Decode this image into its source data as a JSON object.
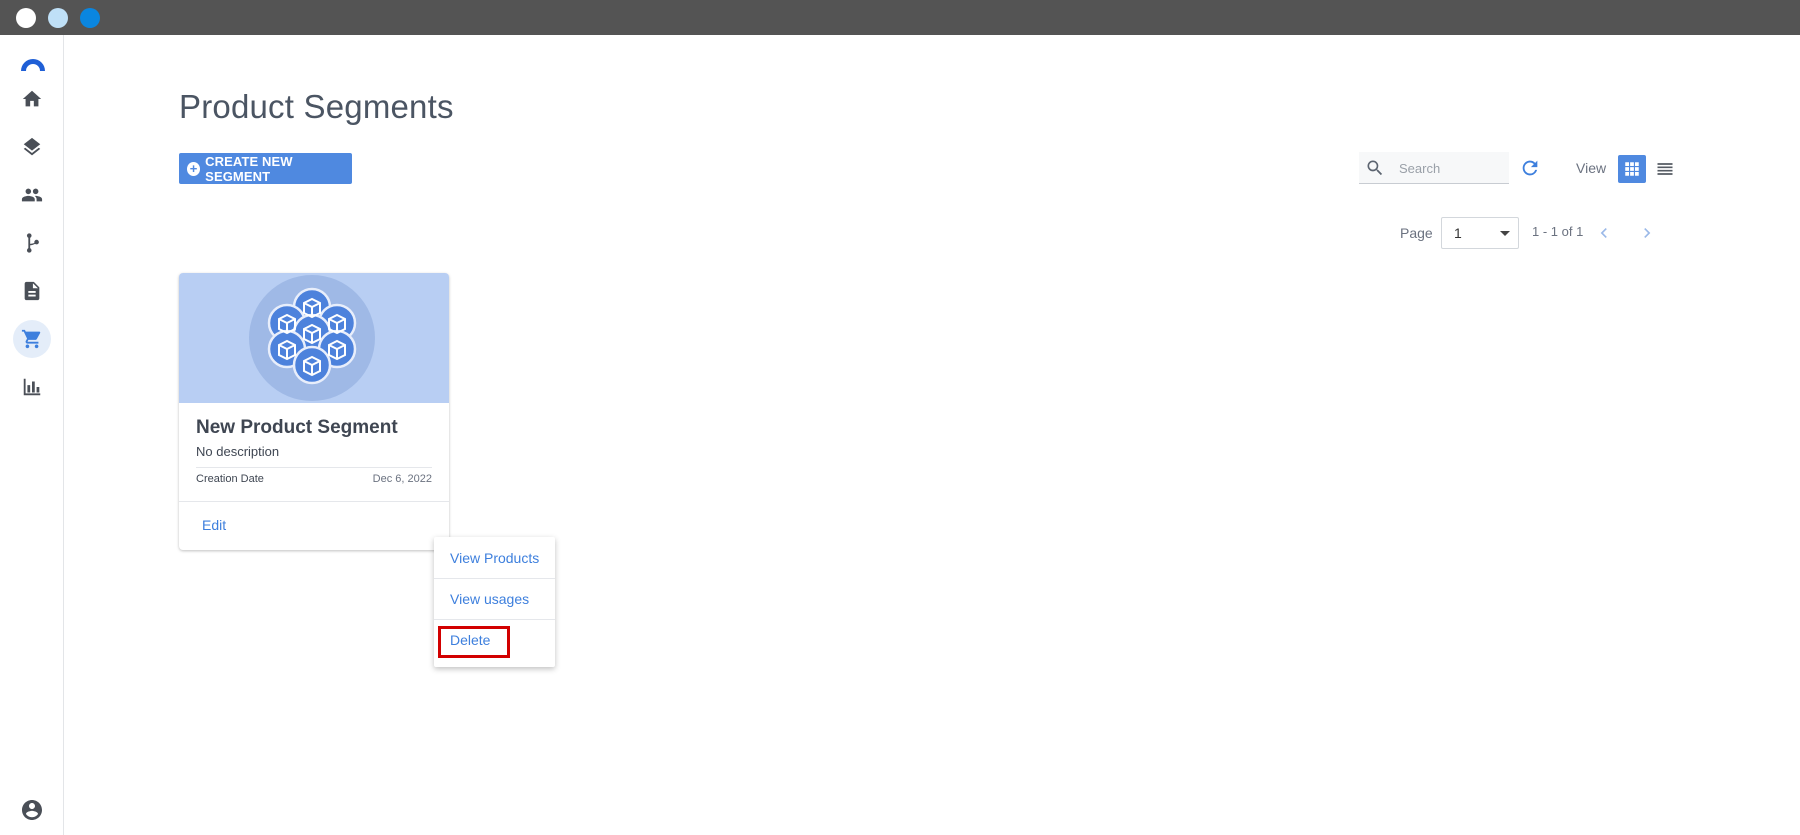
{
  "window": {
    "title": ""
  },
  "sidebar": {
    "items": [
      {
        "name": "home",
        "icon": "home-icon",
        "active": false
      },
      {
        "name": "layers",
        "icon": "layers-icon",
        "active": false
      },
      {
        "name": "people",
        "icon": "people-icon",
        "active": false
      },
      {
        "name": "flow",
        "icon": "flow-icon",
        "active": false
      },
      {
        "name": "document",
        "icon": "document-icon",
        "active": false
      },
      {
        "name": "cart",
        "icon": "cart-icon",
        "active": true
      },
      {
        "name": "chart",
        "icon": "bar-chart-icon",
        "active": false
      }
    ],
    "user_icon": "account-circle-icon"
  },
  "header": {
    "title": "Product Segments",
    "create_button_label": "CREATE NEW SEGMENT"
  },
  "toolbar": {
    "search_placeholder": "Search",
    "view_label": "View",
    "active_view": "grid"
  },
  "pagination": {
    "page_label": "Page",
    "current_page": "1",
    "range_text": "1 - 1 of 1"
  },
  "card": {
    "title": "New Product Segment",
    "description": "No description",
    "date_label": "Creation Date",
    "date_value": "Dec 6, 2022",
    "edit_label": "Edit"
  },
  "context_menu": {
    "items": [
      "View Products",
      "View usages",
      "Delete"
    ],
    "highlighted": "Delete"
  },
  "colors": {
    "accent": "#4f89e0",
    "link": "#3d7fdd",
    "highlight": "#d20000",
    "banner": "#b8cef3"
  }
}
